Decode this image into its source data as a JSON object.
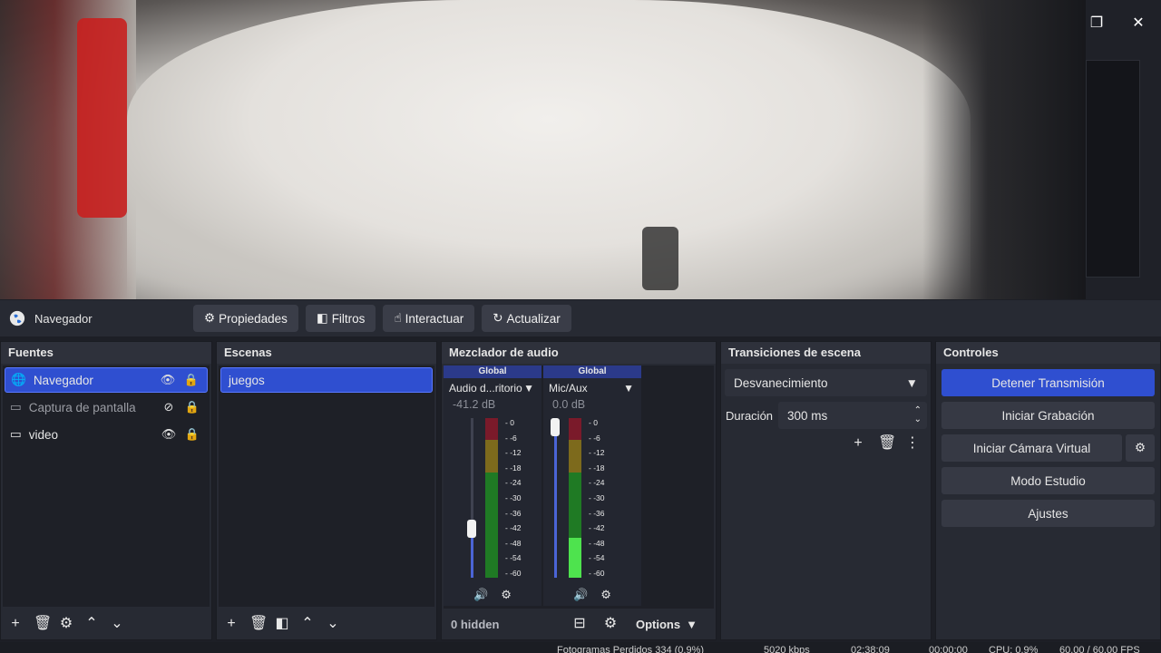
{
  "window": {
    "restore_glyph": "❐",
    "close_glyph": "✕"
  },
  "source_toolbar": {
    "selected_source": "Navegador",
    "buttons": [
      {
        "label": "Propiedades",
        "icon": "gear-icon"
      },
      {
        "label": "Filtros",
        "icon": "filter-icon"
      },
      {
        "label": "Interactuar",
        "icon": "hand-icon"
      },
      {
        "label": "Actualizar",
        "icon": "refresh-icon"
      }
    ]
  },
  "sources": {
    "title": "Fuentes",
    "items": [
      {
        "label": "Navegador",
        "icon": "globe-icon",
        "visible": true,
        "selected": true
      },
      {
        "label": "Captura de pantalla",
        "icon": "monitor-icon",
        "visible": false,
        "selected": false
      },
      {
        "label": "video",
        "icon": "monitor-icon",
        "visible": true,
        "selected": false
      }
    ]
  },
  "scenes": {
    "title": "Escenas",
    "items": [
      {
        "label": "juegos",
        "selected": true
      }
    ]
  },
  "mixer": {
    "title": "Mezclador de audio",
    "strips": [
      {
        "badge": "Global",
        "name": "Audio d...ritorio",
        "db": "-41.2 dB",
        "fader_fraction": 0.28,
        "level_fraction": 0.0
      },
      {
        "badge": "Global",
        "name": "Mic/Aux",
        "db": "0.0 dB",
        "fader_fraction": 1.0,
        "level_fraction": 0.25
      }
    ],
    "ticks": [
      "0",
      "-6",
      "-12",
      "-18",
      "-24",
      "-30",
      "-36",
      "-42",
      "-48",
      "-54",
      "-60"
    ],
    "hidden_label": "0 hidden",
    "options_label": "Options"
  },
  "transitions": {
    "title": "Transiciones de escena",
    "selected": "Desvanecimiento",
    "duration_label": "Duración",
    "duration_value": "300 ms"
  },
  "controls": {
    "title": "Controles",
    "stream_button": "Detener Transmisión",
    "record_button": "Iniciar Grabación",
    "virtual_cam_button": "Iniciar Cámara Virtual",
    "studio_button": "Modo Estudio",
    "settings_button": "Ajustes"
  },
  "status": {
    "dropped_frames": "Fotogramas Perdidos 334 (0.9%)",
    "bitrate": "5020 kbps",
    "live_time": "02:38:09",
    "rec_time": "00:00:00",
    "cpu": "CPU: 0.9%",
    "fps": "60.00 / 60.00 FPS"
  },
  "colors": {
    "accent": "#2f4fd0",
    "panel": "#272a33",
    "vu_green": "#4ee34e"
  }
}
